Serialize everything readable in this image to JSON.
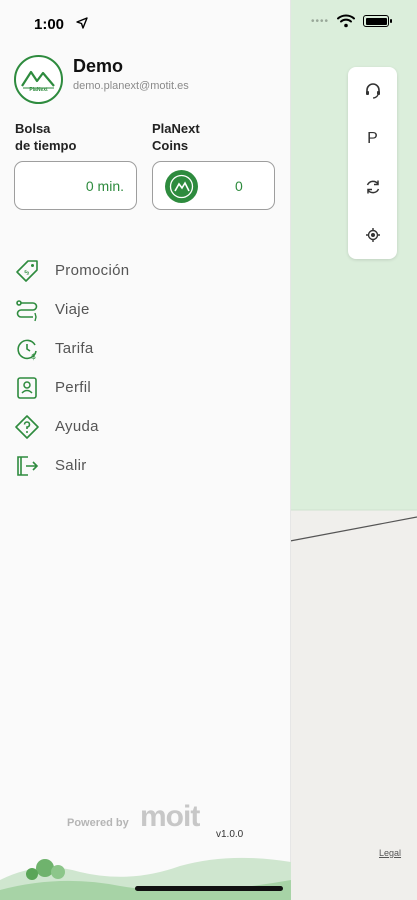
{
  "status": {
    "time": "1:00"
  },
  "user": {
    "name": "Demo",
    "email": "demo.planext@motit.es",
    "avatar_text": "PlaNext"
  },
  "wallet": {
    "time_label": "Bolsa\nde tiempo",
    "time_value": "0 min.",
    "coins_label": "PlaNext\nCoins",
    "coins_value": "0"
  },
  "menu": {
    "items": [
      {
        "label": "Promoción",
        "icon": "tag-icon"
      },
      {
        "label": "Viaje",
        "icon": "route-icon"
      },
      {
        "label": "Tarifa",
        "icon": "clock-icon"
      },
      {
        "label": "Perfil",
        "icon": "profile-icon"
      },
      {
        "label": "Ayuda",
        "icon": "help-icon"
      },
      {
        "label": "Salir",
        "icon": "logout-icon"
      }
    ]
  },
  "footer": {
    "powered_by": "Powered by",
    "logo": "moit",
    "version": "v1.0.0"
  },
  "map": {
    "controls": [
      "support-icon",
      "P",
      "refresh-icon",
      "location-icon"
    ],
    "legal": "Legal"
  },
  "colors": {
    "brand_green": "#2e8b3e",
    "map_green": "#dbeedb"
  }
}
